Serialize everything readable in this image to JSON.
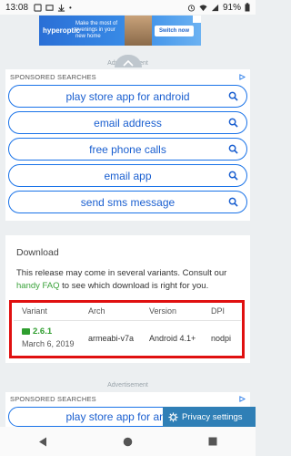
{
  "status_bar": {
    "time": "13:08",
    "battery": "91%"
  },
  "banner_ad": {
    "brand": "hyperoptic",
    "message": "Make the most of evenings in your new home",
    "cta": "Switch now"
  },
  "ad_label": "Advertisement",
  "sponsored": {
    "header": "SPONSORED SEARCHES",
    "items": [
      "play store app for android",
      "email address",
      "free phone calls",
      "email app",
      "send sms message"
    ]
  },
  "download": {
    "title": "Download",
    "desc_prefix": "This release may come in several variants. Consult our ",
    "link": "handy FAQ",
    "desc_suffix": " to see which download is right for you.",
    "headers": {
      "variant": "Variant",
      "arch": "Arch",
      "version": "Version",
      "dpi": "DPI"
    },
    "row": {
      "variant": "2.6.1",
      "date": "March 6, 2019",
      "arch": "armeabi-v7a",
      "version": "Android 4.1+",
      "dpi": "nodpi"
    }
  },
  "ad_label_2": "Advertisement",
  "sponsored_2": {
    "header": "SPONSORED SEARCHES",
    "item": "play store app for android"
  },
  "privacy_button": "Privacy settings",
  "colors": {
    "accent_blue": "#1a73e8",
    "link_green": "#3aa23a",
    "highlight_red": "#e01010",
    "privacy_bg": "#2f7fb6"
  }
}
